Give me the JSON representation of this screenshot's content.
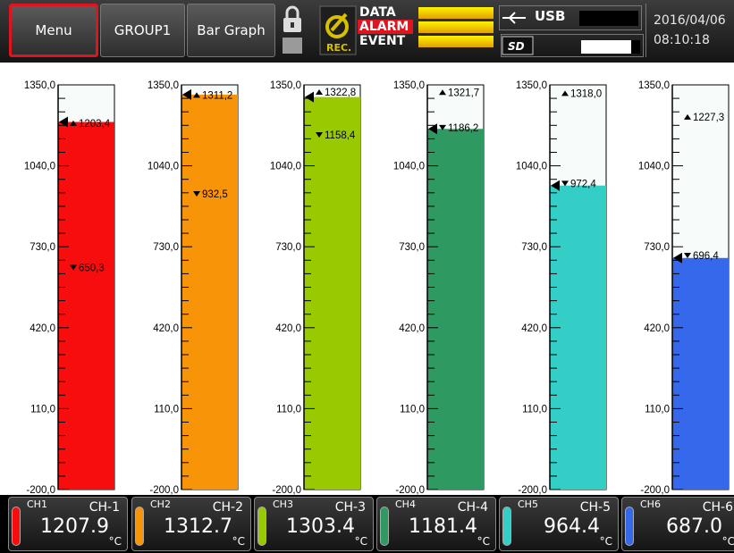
{
  "toolbar": {
    "menu_label": "Menu",
    "group_label": "GROUP1",
    "view_label": "Bar Graph"
  },
  "status": {
    "data_label": "DATA",
    "alarm_label": "ALARM",
    "event_label": "EVENT",
    "rec_label": "REC.",
    "usb_label": "USB",
    "sd_label": "SD"
  },
  "datetime": {
    "date": "2016/04/06",
    "time": "08:10:18"
  },
  "colors": {
    "ch1": "#f70d0d",
    "ch2": "#f79408",
    "ch3": "#99c900",
    "ch4": "#2e9a62",
    "ch5": "#33cfc6",
    "ch6": "#3568ea"
  },
  "chart_data": {
    "type": "bar",
    "ylim": [
      -200,
      1350
    ],
    "tick_labels": [
      "1350,0",
      "1040,0",
      "730,0",
      "420,0",
      "110,0",
      "-200,0"
    ],
    "series": [
      {
        "channel": "CH1",
        "tag": "CH-1",
        "value": 1207.9,
        "value_text": "1207.9",
        "max": 1203.4,
        "max_text": "1203,4",
        "min": 650.3,
        "min_text": "650,3",
        "color": "#f70d0d"
      },
      {
        "channel": "CH2",
        "tag": "CH-2",
        "value": 1312.7,
        "value_text": "1312.7",
        "max": 1311.2,
        "max_text": "1311,2",
        "min": 932.5,
        "min_text": "932,5",
        "color": "#f79408"
      },
      {
        "channel": "CH3",
        "tag": "CH-3",
        "value": 1303.4,
        "value_text": "1303.4",
        "max": 1322.8,
        "max_text": "1322,8",
        "min": 1158.4,
        "min_text": "1158,4",
        "color": "#99c900"
      },
      {
        "channel": "CH4",
        "tag": "CH-4",
        "value": 1181.4,
        "value_text": "1181.4",
        "max": 1321.7,
        "max_text": "1321,7",
        "min": 1186.2,
        "min_text": "1186,2",
        "color": "#2e9a62"
      },
      {
        "channel": "CH5",
        "tag": "CH-5",
        "value": 964.4,
        "value_text": "964.4",
        "max": 1318.0,
        "max_text": "1318,0",
        "min": 972.4,
        "min_text": "972,4",
        "color": "#33cfc6"
      },
      {
        "channel": "CH6",
        "tag": "CH-6",
        "value": 687.0,
        "value_text": "687.0",
        "max": 1227.3,
        "max_text": "1227,3",
        "min": 696.4,
        "min_text": "696,4",
        "color": "#3568ea"
      }
    ],
    "unit": "°C"
  }
}
